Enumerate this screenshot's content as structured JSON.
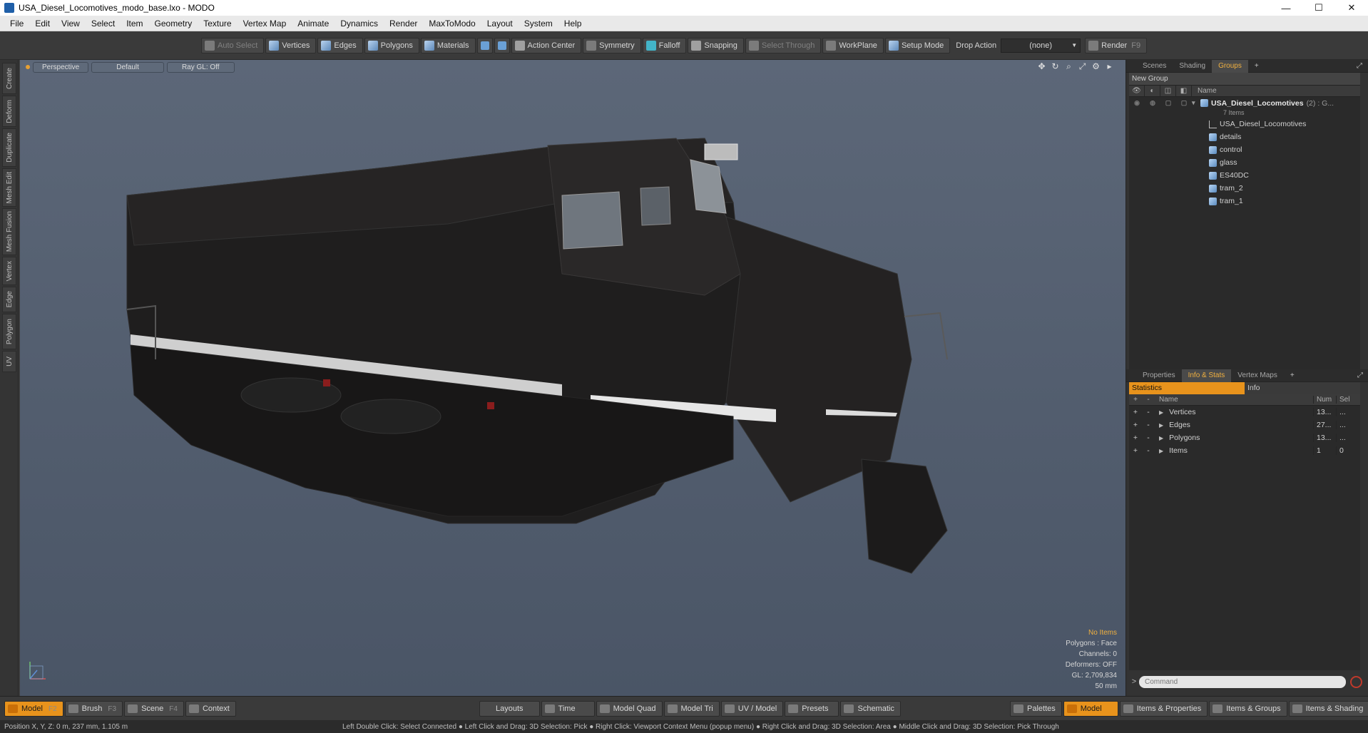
{
  "window": {
    "title": "USA_Diesel_Locomotives_modo_base.lxo - MODO",
    "minimize": "—",
    "maximize": "☐",
    "close": "✕"
  },
  "menu": [
    "File",
    "Edit",
    "View",
    "Select",
    "Item",
    "Geometry",
    "Texture",
    "Vertex Map",
    "Animate",
    "Dynamics",
    "Render",
    "MaxToModo",
    "Layout",
    "System",
    "Help"
  ],
  "toolbar": {
    "auto_select": "Auto Select",
    "vertices": "Vertices",
    "edges": "Edges",
    "polygons": "Polygons",
    "materials": "Materials",
    "action_center": "Action Center",
    "symmetry": "Symmetry",
    "falloff": "Falloff",
    "snapping": "Snapping",
    "select_through": "Select Through",
    "workplane": "WorkPlane",
    "setup_mode": "Setup Mode",
    "drop_action": "Drop Action",
    "drop_action_value": "(none)",
    "render": "Render",
    "render_key": "F9"
  },
  "left_tabs": [
    "Create",
    "Deform",
    "Duplicate",
    "Mesh Edit",
    "Mesh Fusion",
    "Vertex",
    "Edge",
    "Polygon",
    "UV"
  ],
  "viewport": {
    "view": "Perspective",
    "shading": "Default",
    "raygl": "Ray GL: Off",
    "stats": {
      "selection": "No Items",
      "polygons": "Polygons : Face",
      "channels": "Channels: 0",
      "deformers": "Deformers: OFF",
      "gl": "GL: 2,709,834",
      "scale": "50 mm"
    }
  },
  "scene_panel": {
    "tabs": [
      "Scenes",
      "Shading",
      "Groups"
    ],
    "active_tab": "Groups",
    "plus": "+",
    "new_group": "New Group",
    "name_header": "Name",
    "group_name": "USA_Diesel_Locomotives",
    "group_suffix": "(2) : G...",
    "group_count": "7 Items",
    "items": [
      "USA_Diesel_Locomotives",
      "details",
      "control",
      "glass",
      "ES40DC",
      "tram_2",
      "tram_1"
    ]
  },
  "info_panel": {
    "tabs": [
      "Properties",
      "Info & Stats",
      "Vertex Maps"
    ],
    "active_tab": "Info & Stats",
    "plus": "+",
    "subtabs": [
      "Statistics",
      "Info"
    ],
    "headers": {
      "plus": "+",
      "minus": "-",
      "name": "Name",
      "num": "Num",
      "sel": "Sel"
    },
    "rows": [
      {
        "name": "Vertices",
        "num": "13...",
        "sel": "..."
      },
      {
        "name": "Edges",
        "num": "27...",
        "sel": "..."
      },
      {
        "name": "Polygons",
        "num": "13...",
        "sel": "..."
      },
      {
        "name": "Items",
        "num": "1",
        "sel": "0"
      }
    ],
    "command_placeholder": "Command"
  },
  "bottom": {
    "model": "Model",
    "model_key": "F2",
    "brush": "Brush",
    "brush_key": "F3",
    "scene": "Scene",
    "scene_key": "F4",
    "context": "Context",
    "layouts": "Layouts",
    "time": "Time",
    "model_quad": "Model Quad",
    "model_tri": "Model Tri",
    "uv_model": "UV / Model",
    "presets": "Presets",
    "schematic": "Schematic",
    "palettes": "Palettes",
    "model_right": "Model",
    "items_properties": "Items & Properties",
    "items_groups": "Items & Groups",
    "items_shading": "Items & Shading"
  },
  "status": {
    "position": "Position X, Y, Z:   0 m, 237 mm, 1.105 m",
    "hints": "Left Double Click: Select Connected ● Left Click and Drag: 3D Selection: Pick ● Right Click: Viewport Context Menu (popup menu) ● Right Click and Drag: 3D Selection: Area ● Middle Click and Drag: 3D Selection: Pick Through"
  }
}
